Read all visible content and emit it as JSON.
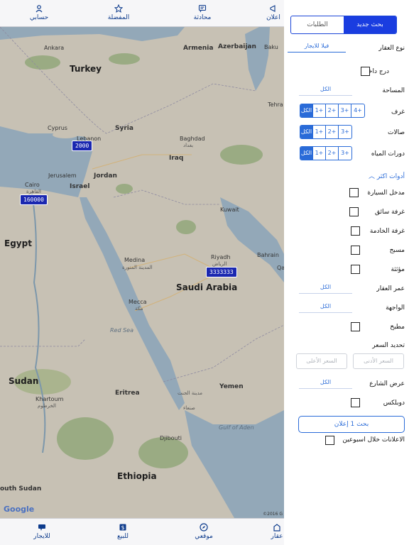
{
  "top_tabs": [
    {
      "label": "حسابي",
      "icon": "person-icon"
    },
    {
      "label": "المفضلة",
      "icon": "star-icon"
    },
    {
      "label": "محادثة",
      "icon": "chat-icon"
    },
    {
      "label": "اعلان",
      "icon": "megaphone-icon"
    }
  ],
  "bottom_tabs": [
    {
      "label": "للايجار",
      "icon": "for-rent-icon"
    },
    {
      "label": "للبيع",
      "icon": "for-sale-icon"
    },
    {
      "label": "موقعي",
      "icon": "compass-icon"
    },
    {
      "label": "عقار",
      "icon": "property-icon"
    }
  ],
  "map": {
    "labels": {
      "turkey": "Turkey",
      "armenia": "Armenia",
      "azerbaijan": "Azerbaijan",
      "baku": "Baku",
      "ankara": "Ankara",
      "cyprus": "Cyprus",
      "syria": "Syria",
      "lebanon": "Lebanon",
      "baghdad": "Baghdad",
      "baghdad_ar": "بغداد",
      "iraq": "Iraq",
      "tehran": "Tehra",
      "jerusalem": "Jerusalem",
      "jordan": "Jordan",
      "israel": "Israel",
      "cairo": "Cairo",
      "cairo_ar": "القاهرة",
      "kuwait": "Kuwait",
      "egypt": "Egypt",
      "medina": "Medina",
      "medina_ar": "المدينة المنورة",
      "riyadh": "Riyadh",
      "riyadh_ar": "الرياض",
      "bahrain": "Bahrain",
      "qatar": "Qa",
      "saudi": "Saudi Arabia",
      "mecca": "Mecca",
      "mecca_ar": "مكة",
      "red_sea": "Red Sea",
      "sudan": "Sudan",
      "khartoum": "Khartoum",
      "khartoum_ar": "الخرطوم",
      "eritrea": "Eritrea",
      "yemen": "Yemen",
      "sanaa": "مدينة الجنت",
      "sanaa2": "صنعاء",
      "gulf_aden": "Gulf of Aden",
      "djibouti": "Djibouti",
      "ethiopia": "Ethiopia",
      "south_sudan": "outh Sudan"
    },
    "markers": [
      "2000",
      "160000",
      "3333333"
    ],
    "google": "Google",
    "copyright": "©2016 G"
  },
  "panel": {
    "tab_new_search": "بحث جديد",
    "tab_requests": "الطلبات",
    "property_type_label": "نوع العقار",
    "property_type_value": "فيلا للايجار",
    "inner_stairs": "درج داخلي",
    "area_label": "المساحة",
    "area_value": "الكل",
    "rooms_label": "غرف",
    "rooms_options": [
      "الكل",
      "1+",
      "2+",
      "3+",
      "4+"
    ],
    "halls_label": "صالات",
    "halls_options": [
      "الكل",
      "1+",
      "2+",
      "3+"
    ],
    "baths_label": "دورات المياه",
    "baths_options": [
      "الكل",
      "1+",
      "2+",
      "3+"
    ],
    "more_tools": "أدوات اكثر",
    "car_entrance": "مدخل السيارة",
    "driver_room": "غرفة سائق",
    "maid_room": "غرفة الخادمة",
    "pool": "مسبح",
    "furnished": "مؤثثة",
    "age_label": "عمر العقار",
    "age_value": "الكل",
    "facade_label": "الواجهة",
    "facade_value": "الكل",
    "kitchen": "مطبخ",
    "price_label": "تحديد السعر",
    "price_min": "السعر الأدنى",
    "price_max": "السعر الأعلى",
    "street_width_label": "عرض الشارع",
    "street_width_value": "الكل",
    "duplex": "دوبلكس",
    "search_button": "بحث 1 إعلان",
    "recent_ads": "الاعلانات خلال اسبوعين"
  }
}
